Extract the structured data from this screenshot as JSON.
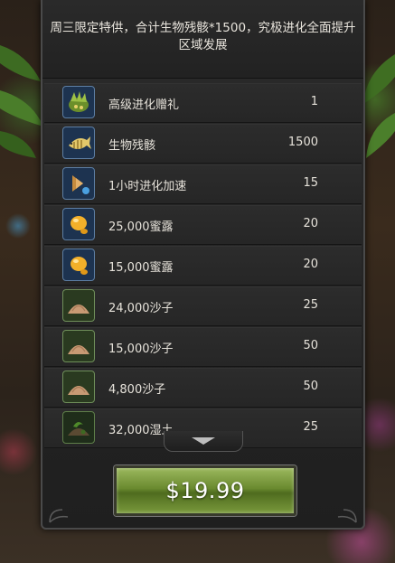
{
  "offer": {
    "header": "周三限定特供，合计生物残骸*1500，究极进化全面提升区域发展",
    "price": "$19.99"
  },
  "items": [
    {
      "name": "高级进化赠礼",
      "qty": "1",
      "icon": "evolution-gift-icon"
    },
    {
      "name": "生物残骸",
      "qty": "1500",
      "icon": "fish-skeleton-icon"
    },
    {
      "name": "1小时进化加速",
      "qty": "15",
      "icon": "speedup-arrow-icon"
    },
    {
      "name": "25,000蜜露",
      "qty": "20",
      "icon": "honeydew-icon"
    },
    {
      "name": "15,000蜜露",
      "qty": "20",
      "icon": "honeydew-icon"
    },
    {
      "name": "24,000沙子",
      "qty": "25",
      "icon": "sand-pile-icon"
    },
    {
      "name": "15,000沙子",
      "qty": "50",
      "icon": "sand-pile-icon"
    },
    {
      "name": "4,800沙子",
      "qty": "50",
      "icon": "sand-pile-icon"
    },
    {
      "name": "32,000湿土",
      "qty": "25",
      "icon": "wet-soil-icon"
    }
  ],
  "colors": {
    "accent_green": "#6a8a2f",
    "icon_frame": "#5d7ea3",
    "text": "#e6e2da"
  }
}
